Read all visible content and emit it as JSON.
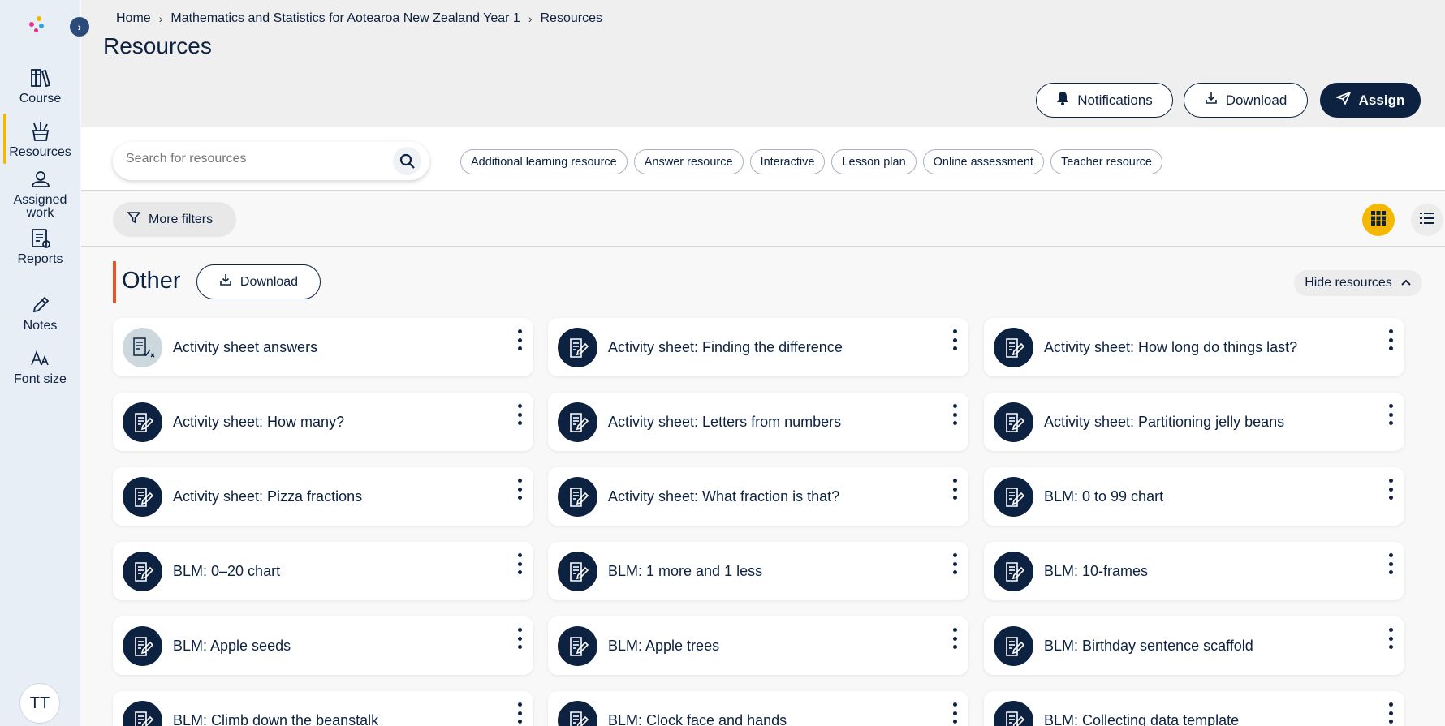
{
  "sidebar": {
    "collapse_icon": "chevron-right-icon",
    "items": [
      {
        "label": "Course",
        "icon": "books-icon"
      },
      {
        "label": "Resources",
        "icon": "resources-icon"
      },
      {
        "label": "Assigned work",
        "icon": "assigned-work-icon"
      },
      {
        "label": "Reports",
        "icon": "reports-icon"
      },
      {
        "label": "Notes",
        "icon": "pencil-icon"
      },
      {
        "label": "Font size",
        "icon": "font-size-icon"
      }
    ],
    "avatar_initials": "TT"
  },
  "breadcrumb": [
    "Home",
    "Mathematics and Statistics for Aotearoa New Zealand Year 1",
    "Resources"
  ],
  "header": {
    "title": "Resources",
    "notifications_label": "Notifications",
    "download_label": "Download",
    "assign_label": "Assign"
  },
  "search": {
    "placeholder": "Search for resources",
    "value": ""
  },
  "chips": [
    "Additional learning resource",
    "Answer resource",
    "Interactive",
    "Lesson plan",
    "Online assessment",
    "Teacher resource"
  ],
  "filters": {
    "more_filters_label": "More filters",
    "active_view": "grid"
  },
  "section": {
    "title": "Other",
    "download_label": "Download",
    "hide_label": "Hide resources"
  },
  "resources": [
    {
      "title": "Activity sheet answers",
      "icon": "answer-sheet-icon"
    },
    {
      "title": "Activity sheet: Finding the difference",
      "icon": "worksheet-icon"
    },
    {
      "title": "Activity sheet: How long do things last?",
      "icon": "worksheet-icon"
    },
    {
      "title": "Activity sheet: How many?",
      "icon": "worksheet-icon"
    },
    {
      "title": "Activity sheet: Letters from numbers",
      "icon": "worksheet-icon"
    },
    {
      "title": "Activity sheet: Partitioning jelly beans",
      "icon": "worksheet-icon"
    },
    {
      "title": "Activity sheet: Pizza fractions",
      "icon": "worksheet-icon"
    },
    {
      "title": "Activity sheet: What fraction is that?",
      "icon": "worksheet-icon"
    },
    {
      "title": "BLM: 0 to 99 chart",
      "icon": "worksheet-icon"
    },
    {
      "title": "BLM: 0–20 chart",
      "icon": "worksheet-icon"
    },
    {
      "title": "BLM: 1 more and 1 less",
      "icon": "worksheet-icon"
    },
    {
      "title": "BLM: 10-frames",
      "icon": "worksheet-icon"
    },
    {
      "title": "BLM: Apple seeds",
      "icon": "worksheet-icon"
    },
    {
      "title": "BLM: Apple trees",
      "icon": "worksheet-icon"
    },
    {
      "title": "BLM: Birthday sentence scaffold",
      "icon": "worksheet-icon"
    },
    {
      "title": "BLM: Climb down the beanstalk",
      "icon": "worksheet-icon"
    },
    {
      "title": "BLM: Clock face and hands",
      "icon": "worksheet-icon"
    },
    {
      "title": "BLM: Collecting data template",
      "icon": "worksheet-icon"
    }
  ],
  "colors": {
    "navy": "#0d2240",
    "accent_yellow": "#f5b800",
    "section_marker": "#e8552a"
  }
}
